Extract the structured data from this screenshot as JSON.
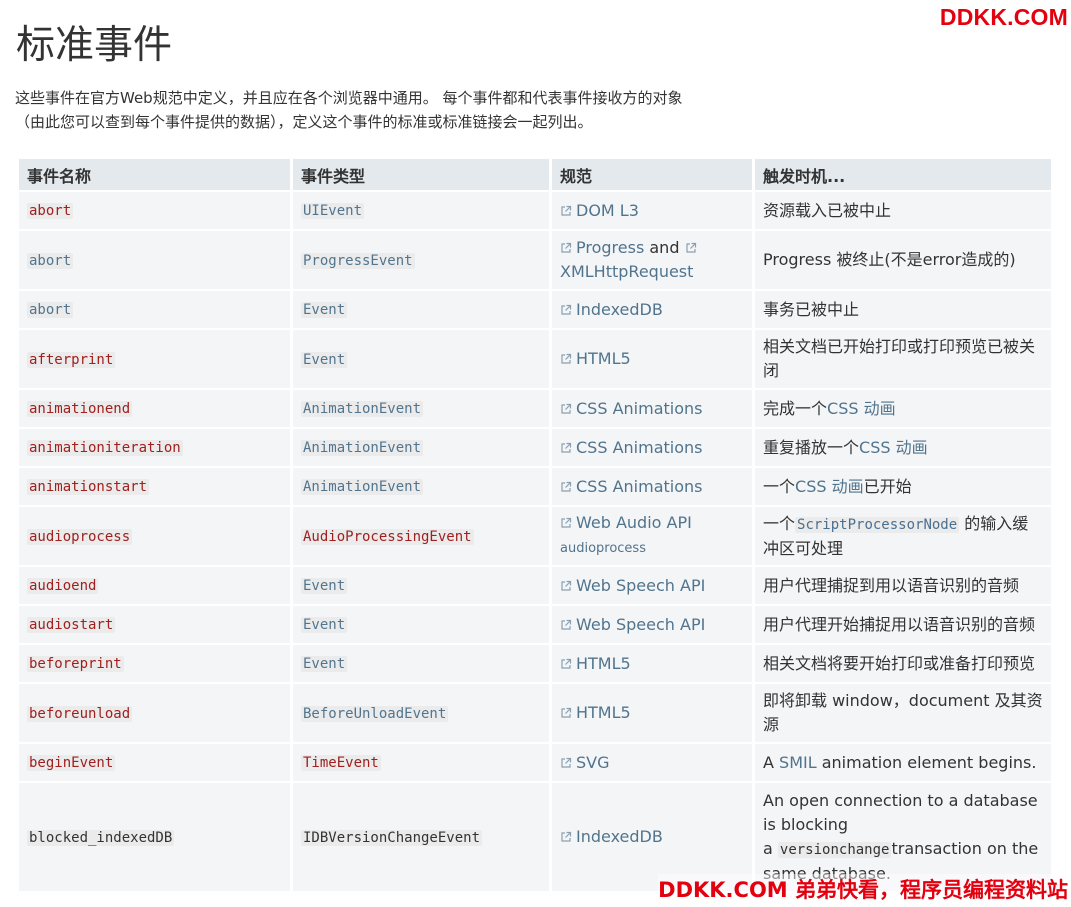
{
  "watermark_top": "DDKK.COM",
  "watermark_bottom": "DDKK.COM 弟弟快看，程序员编程资料站",
  "title": "标准事件",
  "intro": "这些事件在官方Web规范中定义，并且应在各个浏览器中通用。 每个事件都和代表事件接收方的对象（由此您可以查到每个事件提供的数据），定义这个事件的标准或标准链接会一起列出。",
  "table": {
    "headers": [
      "事件名称",
      "事件类型",
      "规范",
      "触发时机..."
    ],
    "rows": [
      {
        "name": "abort",
        "type": "UIEvent",
        "spec": "DOM L3",
        "desc": "资源载入已被中止"
      },
      {
        "name": "abort",
        "type": "ProgressEvent",
        "spec": "Progress",
        "spec_and": "and",
        "spec2": "XMLHttpRequest",
        "desc": "Progress 被终止(不是error造成的)"
      },
      {
        "name": "abort",
        "type": "Event",
        "spec": "IndexedDB",
        "desc": "事务已被中止"
      },
      {
        "name": "afterprint",
        "type": "Event",
        "spec": "HTML5",
        "desc": "相关文档已开始打印或打印预览已被关闭"
      },
      {
        "name": "animationend",
        "type": "AnimationEvent",
        "spec": "CSS Animations",
        "desc_pre": "完成一个",
        "desc_link": "CSS 动画",
        "desc_post": ""
      },
      {
        "name": "animationiteration",
        "type": "AnimationEvent",
        "spec": "CSS Animations",
        "desc_pre": "重复播放一个",
        "desc_link": "CSS 动画",
        "desc_post": ""
      },
      {
        "name": "animationstart",
        "type": "AnimationEvent",
        "spec": "CSS Animations",
        "desc_pre": "一个",
        "desc_link": "CSS 动画",
        "desc_post": "已开始"
      },
      {
        "name": "audioprocess",
        "type": "AudioProcessingEvent",
        "spec": "Web Audio API",
        "spec_sub": "audioprocess",
        "desc_pre": "一个",
        "desc_code": "ScriptProcessorNode",
        "desc_post": " 的输入缓冲区可处理"
      },
      {
        "name": "audioend",
        "type": "Event",
        "spec": "Web Speech API",
        "desc": "用户代理捕捉到用以语音识别的音频"
      },
      {
        "name": "audiostart",
        "type": "Event",
        "spec": "Web Speech API",
        "desc": "用户代理开始捕捉用以语音识别的音频"
      },
      {
        "name": "beforeprint",
        "type": "Event",
        "spec": "HTML5",
        "desc": "相关文档将要开始打印或准备打印预览"
      },
      {
        "name": "beforeunload",
        "type": "BeforeUnloadEvent",
        "spec": "HTML5",
        "desc": "即将卸载 window，document 及其资源"
      },
      {
        "name": "beginEvent",
        "type": "TimeEvent",
        "spec": "SVG",
        "desc_pre": "A ",
        "desc_link": "SMIL",
        "desc_post": " animation element begins."
      },
      {
        "name": "blocked_indexedDB",
        "type": "IDBVersionChangeEvent",
        "spec": "IndexedDB",
        "desc_line1": "An open connection to a database is blocking",
        "desc_pre": "a ",
        "desc_code": "versionchange",
        "desc_post": "transaction on the same database."
      }
    ]
  },
  "colors": {
    "accent_link": "#51748d",
    "event_red": "#a02020",
    "watermark": "#e3000f",
    "header_bg": "#e4e9ee",
    "cell_bg": "#f4f5f7"
  }
}
